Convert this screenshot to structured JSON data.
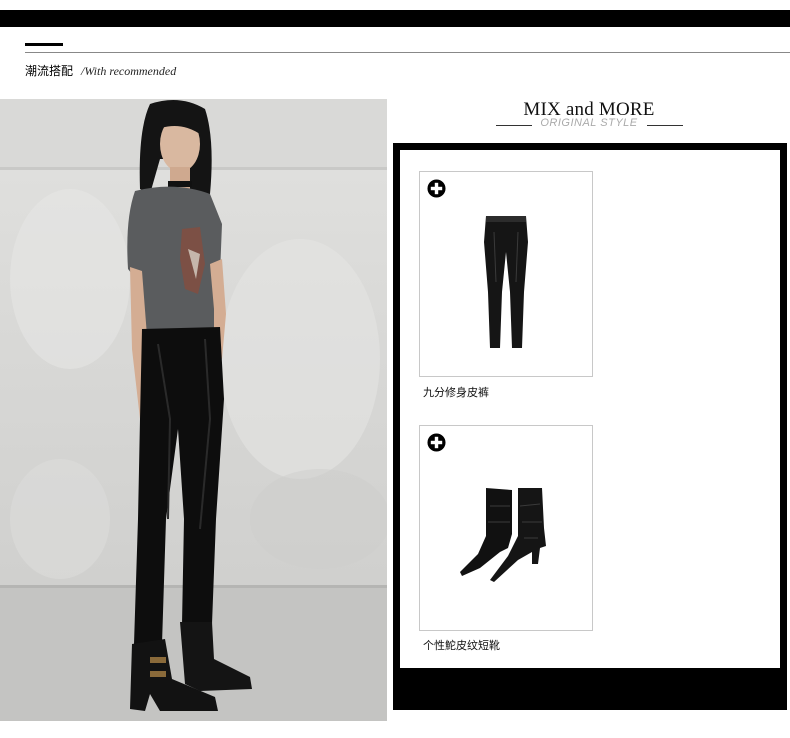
{
  "section": {
    "title_cn": "潮流搭配",
    "title_en": "/With recommended"
  },
  "brand": {
    "title": "MIX and MORE",
    "subtitle": "ORIGINAL STYLE"
  },
  "products": [
    {
      "name": "九分修身皮裤",
      "icon": "plus-circle-icon"
    },
    {
      "name": "个性鮀皮纹短靴",
      "icon": "plus-circle-icon"
    }
  ],
  "colors": {
    "frame": "#000000",
    "rule": "#888888",
    "subtitle": "#aaaaaa"
  }
}
